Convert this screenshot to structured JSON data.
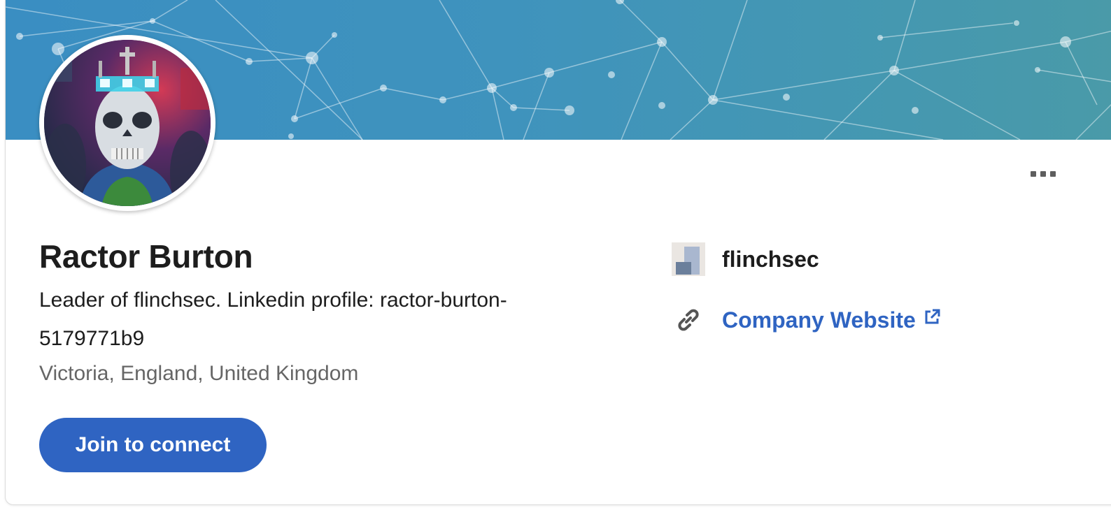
{
  "profile": {
    "name": "Ractor Burton",
    "headline": "Leader of flinchsec. Linkedin profile: ractor-burton-5179771b9",
    "location": "Victoria, England, United Kingdom",
    "avatar_alt": "profile-photo-skull-crown"
  },
  "actions": {
    "join_label": "Join to connect",
    "more_icon": "more-horizontal-icon"
  },
  "sidebar": {
    "organization": "flinchsec",
    "website_label": "Company Website",
    "link_icon": "link-icon",
    "external_icon": "external-link-icon"
  },
  "colors": {
    "brand_blue": "#2f64c2",
    "banner_start": "#3a8ec2",
    "banner_end": "#4a9aa8",
    "text_primary": "#1d1d1d",
    "text_secondary": "#666666"
  }
}
